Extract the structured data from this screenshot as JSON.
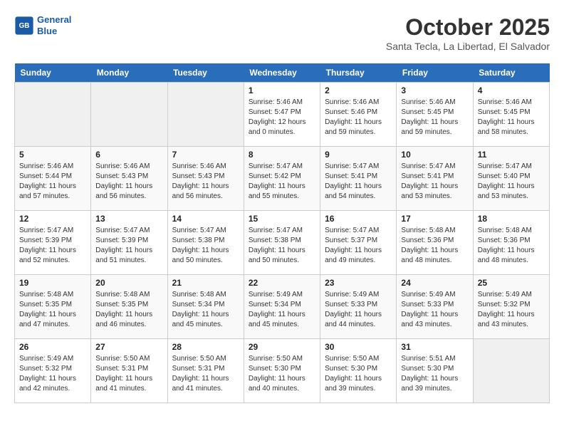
{
  "header": {
    "logo_line1": "General",
    "logo_line2": "Blue",
    "month_year": "October 2025",
    "location": "Santa Tecla, La Libertad, El Salvador"
  },
  "weekdays": [
    "Sunday",
    "Monday",
    "Tuesday",
    "Wednesday",
    "Thursday",
    "Friday",
    "Saturday"
  ],
  "weeks": [
    [
      {
        "day": "",
        "content": ""
      },
      {
        "day": "",
        "content": ""
      },
      {
        "day": "",
        "content": ""
      },
      {
        "day": "1",
        "content": "Sunrise: 5:46 AM\nSunset: 5:47 PM\nDaylight: 12 hours\nand 0 minutes."
      },
      {
        "day": "2",
        "content": "Sunrise: 5:46 AM\nSunset: 5:46 PM\nDaylight: 11 hours\nand 59 minutes."
      },
      {
        "day": "3",
        "content": "Sunrise: 5:46 AM\nSunset: 5:45 PM\nDaylight: 11 hours\nand 59 minutes."
      },
      {
        "day": "4",
        "content": "Sunrise: 5:46 AM\nSunset: 5:45 PM\nDaylight: 11 hours\nand 58 minutes."
      }
    ],
    [
      {
        "day": "5",
        "content": "Sunrise: 5:46 AM\nSunset: 5:44 PM\nDaylight: 11 hours\nand 57 minutes."
      },
      {
        "day": "6",
        "content": "Sunrise: 5:46 AM\nSunset: 5:43 PM\nDaylight: 11 hours\nand 56 minutes."
      },
      {
        "day": "7",
        "content": "Sunrise: 5:46 AM\nSunset: 5:43 PM\nDaylight: 11 hours\nand 56 minutes."
      },
      {
        "day": "8",
        "content": "Sunrise: 5:47 AM\nSunset: 5:42 PM\nDaylight: 11 hours\nand 55 minutes."
      },
      {
        "day": "9",
        "content": "Sunrise: 5:47 AM\nSunset: 5:41 PM\nDaylight: 11 hours\nand 54 minutes."
      },
      {
        "day": "10",
        "content": "Sunrise: 5:47 AM\nSunset: 5:41 PM\nDaylight: 11 hours\nand 53 minutes."
      },
      {
        "day": "11",
        "content": "Sunrise: 5:47 AM\nSunset: 5:40 PM\nDaylight: 11 hours\nand 53 minutes."
      }
    ],
    [
      {
        "day": "12",
        "content": "Sunrise: 5:47 AM\nSunset: 5:39 PM\nDaylight: 11 hours\nand 52 minutes."
      },
      {
        "day": "13",
        "content": "Sunrise: 5:47 AM\nSunset: 5:39 PM\nDaylight: 11 hours\nand 51 minutes."
      },
      {
        "day": "14",
        "content": "Sunrise: 5:47 AM\nSunset: 5:38 PM\nDaylight: 11 hours\nand 50 minutes."
      },
      {
        "day": "15",
        "content": "Sunrise: 5:47 AM\nSunset: 5:38 PM\nDaylight: 11 hours\nand 50 minutes."
      },
      {
        "day": "16",
        "content": "Sunrise: 5:47 AM\nSunset: 5:37 PM\nDaylight: 11 hours\nand 49 minutes."
      },
      {
        "day": "17",
        "content": "Sunrise: 5:48 AM\nSunset: 5:36 PM\nDaylight: 11 hours\nand 48 minutes."
      },
      {
        "day": "18",
        "content": "Sunrise: 5:48 AM\nSunset: 5:36 PM\nDaylight: 11 hours\nand 48 minutes."
      }
    ],
    [
      {
        "day": "19",
        "content": "Sunrise: 5:48 AM\nSunset: 5:35 PM\nDaylight: 11 hours\nand 47 minutes."
      },
      {
        "day": "20",
        "content": "Sunrise: 5:48 AM\nSunset: 5:35 PM\nDaylight: 11 hours\nand 46 minutes."
      },
      {
        "day": "21",
        "content": "Sunrise: 5:48 AM\nSunset: 5:34 PM\nDaylight: 11 hours\nand 45 minutes."
      },
      {
        "day": "22",
        "content": "Sunrise: 5:49 AM\nSunset: 5:34 PM\nDaylight: 11 hours\nand 45 minutes."
      },
      {
        "day": "23",
        "content": "Sunrise: 5:49 AM\nSunset: 5:33 PM\nDaylight: 11 hours\nand 44 minutes."
      },
      {
        "day": "24",
        "content": "Sunrise: 5:49 AM\nSunset: 5:33 PM\nDaylight: 11 hours\nand 43 minutes."
      },
      {
        "day": "25",
        "content": "Sunrise: 5:49 AM\nSunset: 5:32 PM\nDaylight: 11 hours\nand 43 minutes."
      }
    ],
    [
      {
        "day": "26",
        "content": "Sunrise: 5:49 AM\nSunset: 5:32 PM\nDaylight: 11 hours\nand 42 minutes."
      },
      {
        "day": "27",
        "content": "Sunrise: 5:50 AM\nSunset: 5:31 PM\nDaylight: 11 hours\nand 41 minutes."
      },
      {
        "day": "28",
        "content": "Sunrise: 5:50 AM\nSunset: 5:31 PM\nDaylight: 11 hours\nand 41 minutes."
      },
      {
        "day": "29",
        "content": "Sunrise: 5:50 AM\nSunset: 5:30 PM\nDaylight: 11 hours\nand 40 minutes."
      },
      {
        "day": "30",
        "content": "Sunrise: 5:50 AM\nSunset: 5:30 PM\nDaylight: 11 hours\nand 39 minutes."
      },
      {
        "day": "31",
        "content": "Sunrise: 5:51 AM\nSunset: 5:30 PM\nDaylight: 11 hours\nand 39 minutes."
      },
      {
        "day": "",
        "content": ""
      }
    ]
  ]
}
